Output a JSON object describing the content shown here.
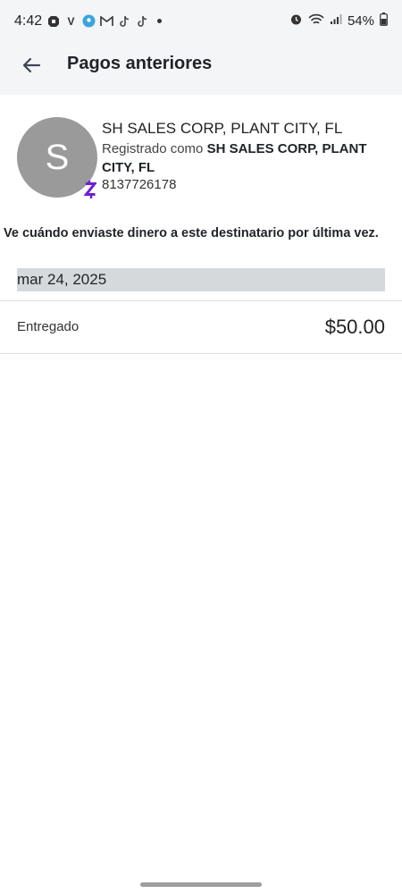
{
  "status_bar": {
    "time": "4:42",
    "battery": "54%"
  },
  "header": {
    "title": "Pagos anteriores"
  },
  "recipient": {
    "avatar_letter": "S",
    "name": "SH SALES CORP, PLANT CITY, FL",
    "registered_prefix": "Registrado como ",
    "registered_name": "SH SALES CORP, PLANT CITY, FL",
    "phone": "8137726178"
  },
  "info_text": "Ve cuándo enviaste dinero a este destinatario por última vez.",
  "payments": [
    {
      "date": "mar 24, 2025",
      "status": "Entregado",
      "amount": "$50.00"
    }
  ],
  "colors": {
    "header_bg": "#f4f5f7",
    "avatar_bg": "#9a9a9a",
    "zelle_purple": "#6d1ed4",
    "date_header_bg": "#d6d9dc"
  }
}
